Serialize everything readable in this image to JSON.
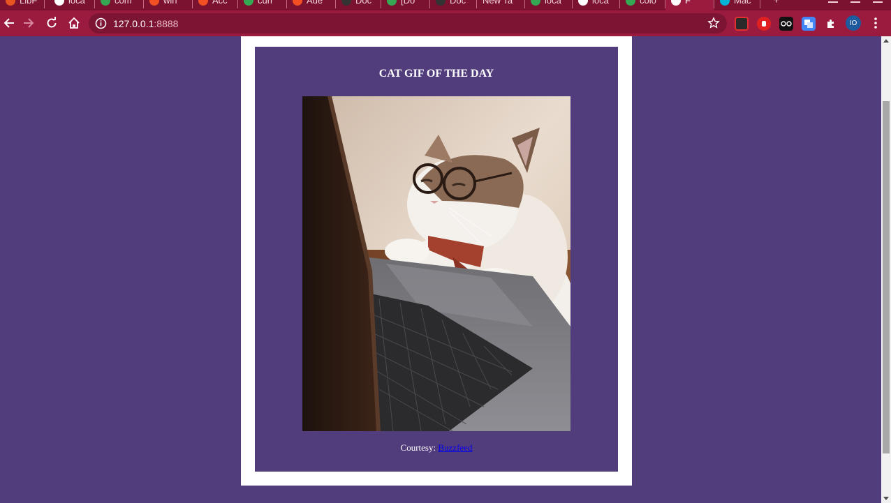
{
  "browser": {
    "tabs": [
      {
        "title": "LibF",
        "favicon_color": "#e95420"
      },
      {
        "title": "loca",
        "favicon_color": "#ffffff"
      },
      {
        "title": "com",
        "favicon_color": "#34a853"
      },
      {
        "title": "win",
        "favicon_color": "#f25022"
      },
      {
        "title": "Acc",
        "favicon_color": "#f25022"
      },
      {
        "title": "curr",
        "favicon_color": "#34a853"
      },
      {
        "title": "Ade",
        "favicon_color": "#f25022"
      },
      {
        "title": "Doc",
        "favicon_color": "#333333"
      },
      {
        "title": "[Do",
        "favicon_color": "#34a853"
      },
      {
        "title": "Doc",
        "favicon_color": "#333333"
      },
      {
        "title": "New Ta",
        "favicon_color": ""
      },
      {
        "title": "loca",
        "favicon_color": "#34a853"
      },
      {
        "title": "loca",
        "favicon_color": "#ffffff"
      },
      {
        "title": "colo",
        "favicon_color": "#34a853"
      },
      {
        "title": "F",
        "favicon_color": "#ffffff",
        "active": true
      },
      {
        "title": "Mac",
        "favicon_color": "#00b4d8"
      }
    ],
    "new_tab_glyph": "+",
    "url_host": "127.0.0.1",
    "url_port": ":8888",
    "profile_initials": "IO",
    "theme": {
      "frame": "#7b1330",
      "toolbar": "#9b1b3f",
      "omnibox": "#7c1433"
    }
  },
  "page": {
    "background": "#523d7c",
    "heading": "CAT GIF OF THE DAY",
    "credit_prefix": "Courtesy: ",
    "credit_link": "Buzzfeed",
    "image_alt": "cat wearing glasses and a tie typing on a laptop"
  }
}
